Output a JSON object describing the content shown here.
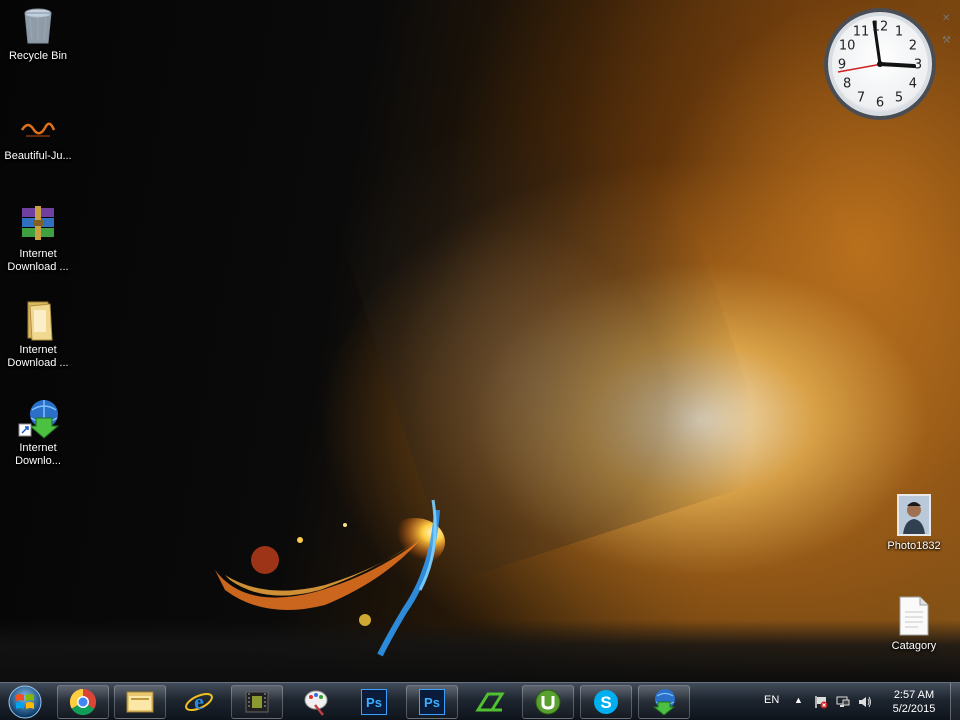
{
  "desktop": {
    "icons": [
      {
        "label": "Recycle Bin",
        "icon": "recycle-bin-icon"
      },
      {
        "label": "Beautiful-Ju...",
        "icon": "jumma-mubarak-image-icon"
      },
      {
        "label": "Internet Download ...",
        "icon": "winrar-archive-icon"
      },
      {
        "label": "Internet Download ...",
        "icon": "folder-icon"
      },
      {
        "label": "Internet Downlo...",
        "icon": "internet-download-manager-shortcut-icon"
      },
      {
        "label": "Photo1832",
        "icon": "photo-thumbnail-icon"
      },
      {
        "label": "Catagory",
        "icon": "text-document-icon"
      }
    ],
    "clock": {
      "numbers": [
        "12",
        "1",
        "2",
        "3",
        "4",
        "5",
        "6",
        "7",
        "8",
        "9",
        "10",
        "11"
      ]
    }
  },
  "taskbar": {
    "apps": [
      {
        "name": "chrome",
        "icon": "chrome-icon"
      },
      {
        "name": "explorer",
        "icon": "file-explorer-icon"
      },
      {
        "name": "internet-explorer",
        "icon": "internet-explorer-icon"
      },
      {
        "name": "media-app",
        "icon": "film-icon"
      },
      {
        "name": "paint-app",
        "icon": "paint-icon"
      },
      {
        "name": "photoshop-1",
        "label": "Ps",
        "icon": "photoshop-icon"
      },
      {
        "name": "photoshop-2",
        "label": "Ps",
        "icon": "photoshop-icon"
      },
      {
        "name": "camtasia",
        "icon": "camtasia-icon"
      },
      {
        "name": "utorrent",
        "icon": "utorrent-icon"
      },
      {
        "name": "skype",
        "icon": "skype-icon"
      },
      {
        "name": "idm",
        "icon": "internet-download-manager-icon"
      }
    ],
    "tray": {
      "language": "EN",
      "show_hidden": "▲",
      "time": "2:57 AM",
      "date": "5/2/2015"
    }
  },
  "colors": {
    "taskbar": "#1e2630",
    "accent": "#e0a040"
  }
}
